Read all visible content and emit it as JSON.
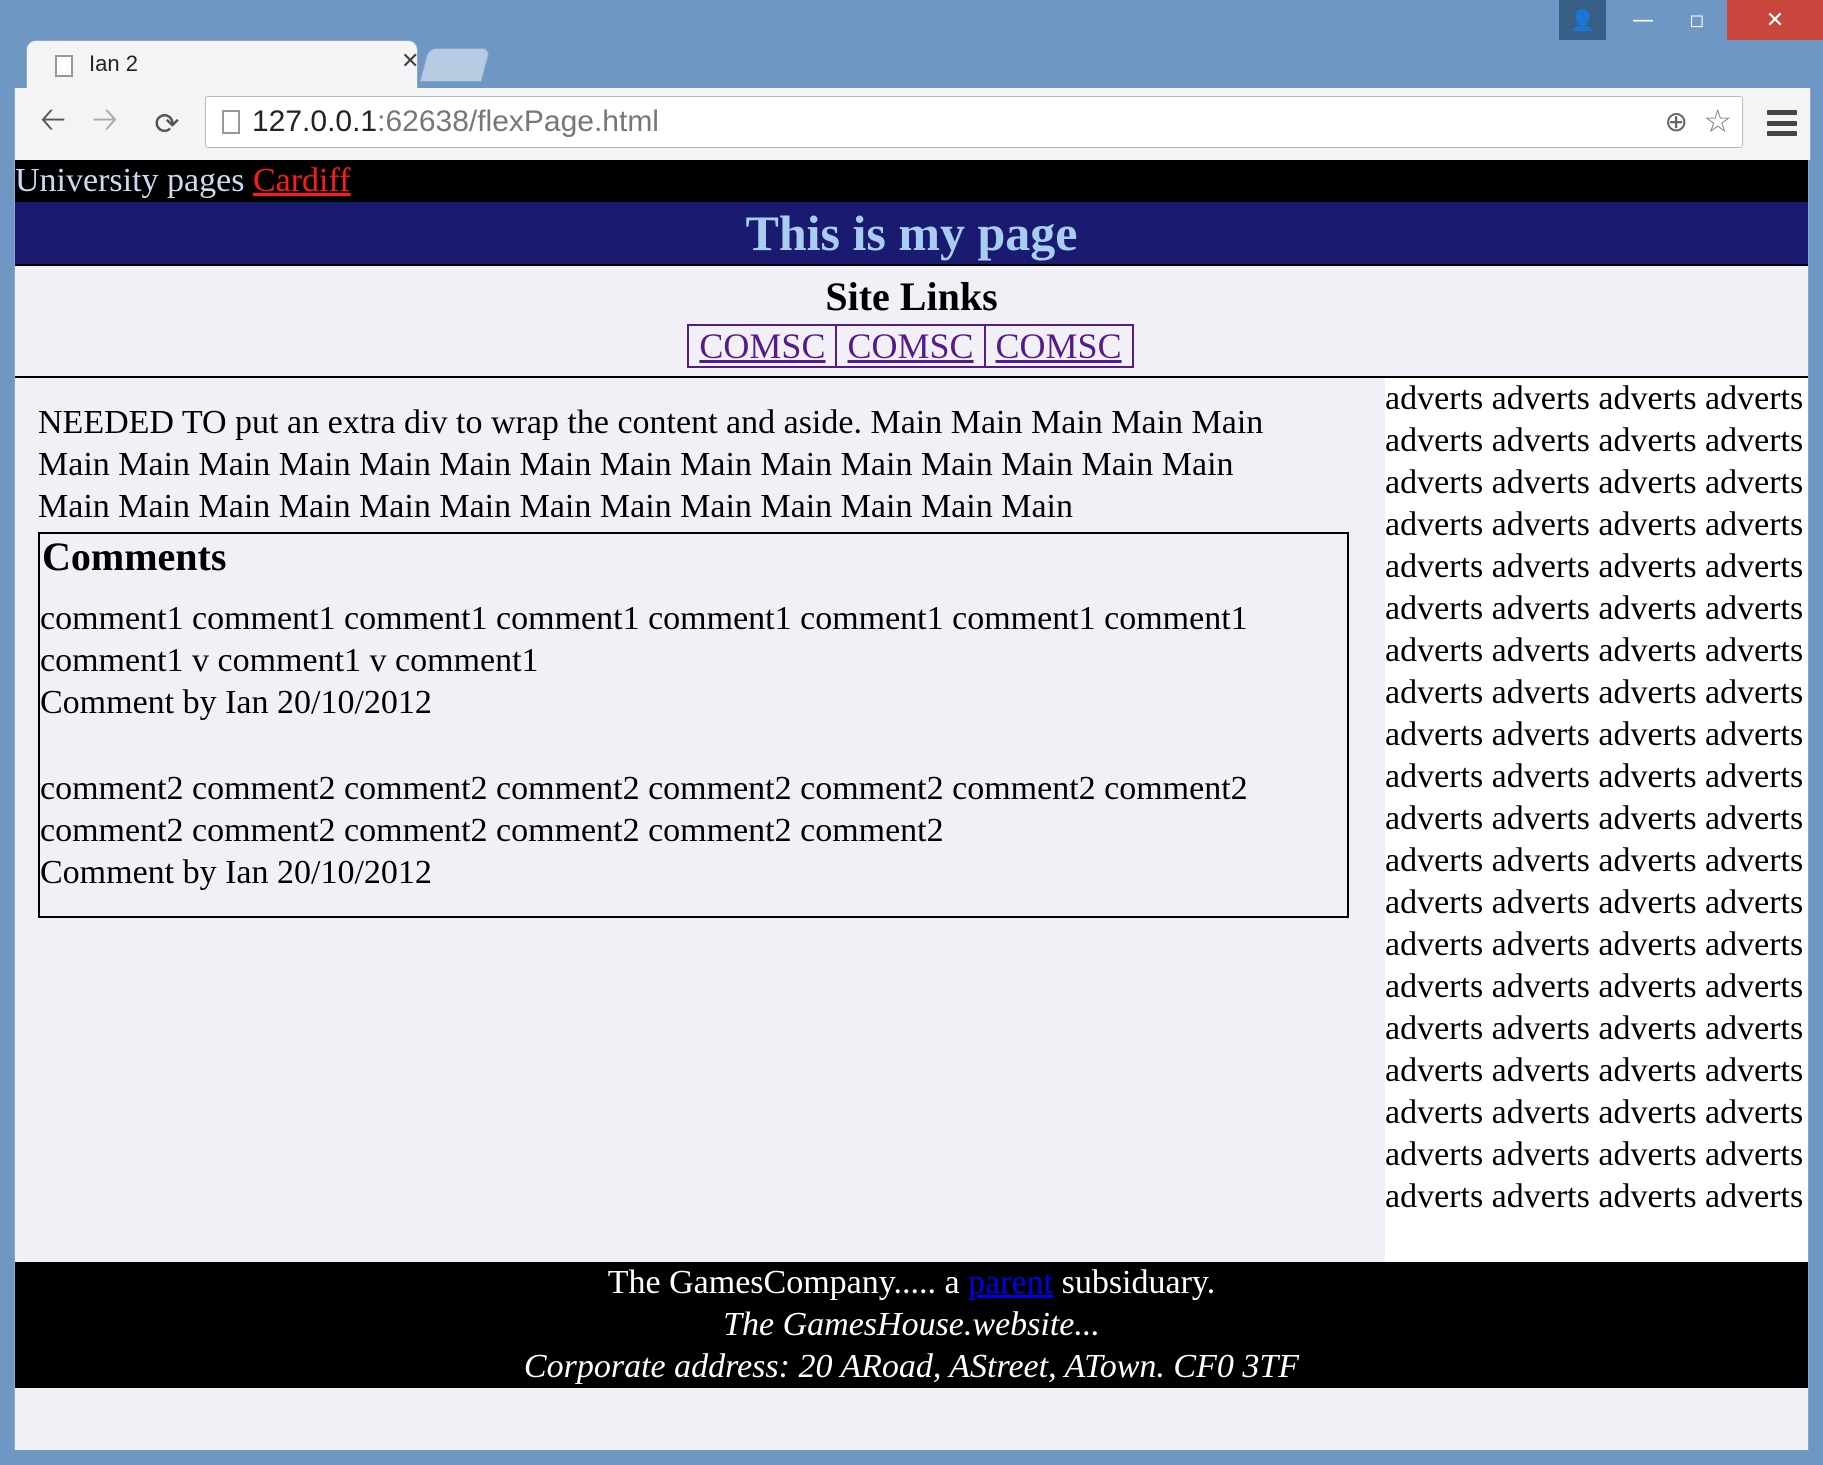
{
  "browser": {
    "tab_title": "Ian 2",
    "url_host": "127.0.0.1",
    "url_rest": ":62638/flexPage.html"
  },
  "page": {
    "uni_bar_text": "University pages ",
    "uni_bar_link": "Cardiff",
    "title": "This is my page",
    "site_links_heading": "Site Links",
    "site_links": [
      "COMSC",
      "COMSC",
      "COMSC"
    ],
    "main_text": "NEEDED TO put an extra div to wrap the content and aside. Main Main Main Main Main Main Main Main Main Main Main Main Main Main Main Main Main Main Main Main Main Main Main Main Main Main Main Main Main Main Main Main Main",
    "comments_heading": "Comments",
    "comments": [
      {
        "text": "comment1 comment1 comment1 comment1 comment1 comment1 comment1 comment1 comment1 v comment1 v comment1",
        "byline": "Comment by Ian 20/10/2012"
      },
      {
        "text": "comment2 comment2 comment2 comment2 comment2 comment2 comment2 comment2 comment2 comment2 comment2 comment2 comment2 comment2",
        "byline": "Comment by Ian 20/10/2012"
      }
    ],
    "aside_text": "adverts adverts adverts adverts adverts adverts adverts adverts adverts adverts adverts adverts adverts adverts adverts adverts adverts adverts adverts adverts adverts adverts adverts adverts adverts adverts adverts adverts adverts adverts adverts adverts adverts adverts adverts adverts adverts adverts adverts adverts adverts adverts adverts adverts adverts adverts adverts adverts adverts adverts adverts adverts adverts adverts adverts adverts adverts adverts adverts adverts adverts adverts adverts adverts adverts adverts adverts adverts adverts adverts adverts adverts adverts adverts adverts adverts adverts adverts adverts adverts",
    "footer_line1_a": "The GamesCompany..... a ",
    "footer_line1_link": "parent",
    "footer_line1_b": " subsiduary.",
    "footer_line2": "The GamesHouse.website...",
    "footer_line3": "Corporate address: 20 ARoad, AStreet, ATown. CF0 3TF"
  },
  "colors": {
    "uni_link": "#ff1a1a",
    "header_bg": "#1a1a70",
    "header_text": "#a9cdf0",
    "visited_link": "#551a8b",
    "footer_link": "#0000ee"
  }
}
